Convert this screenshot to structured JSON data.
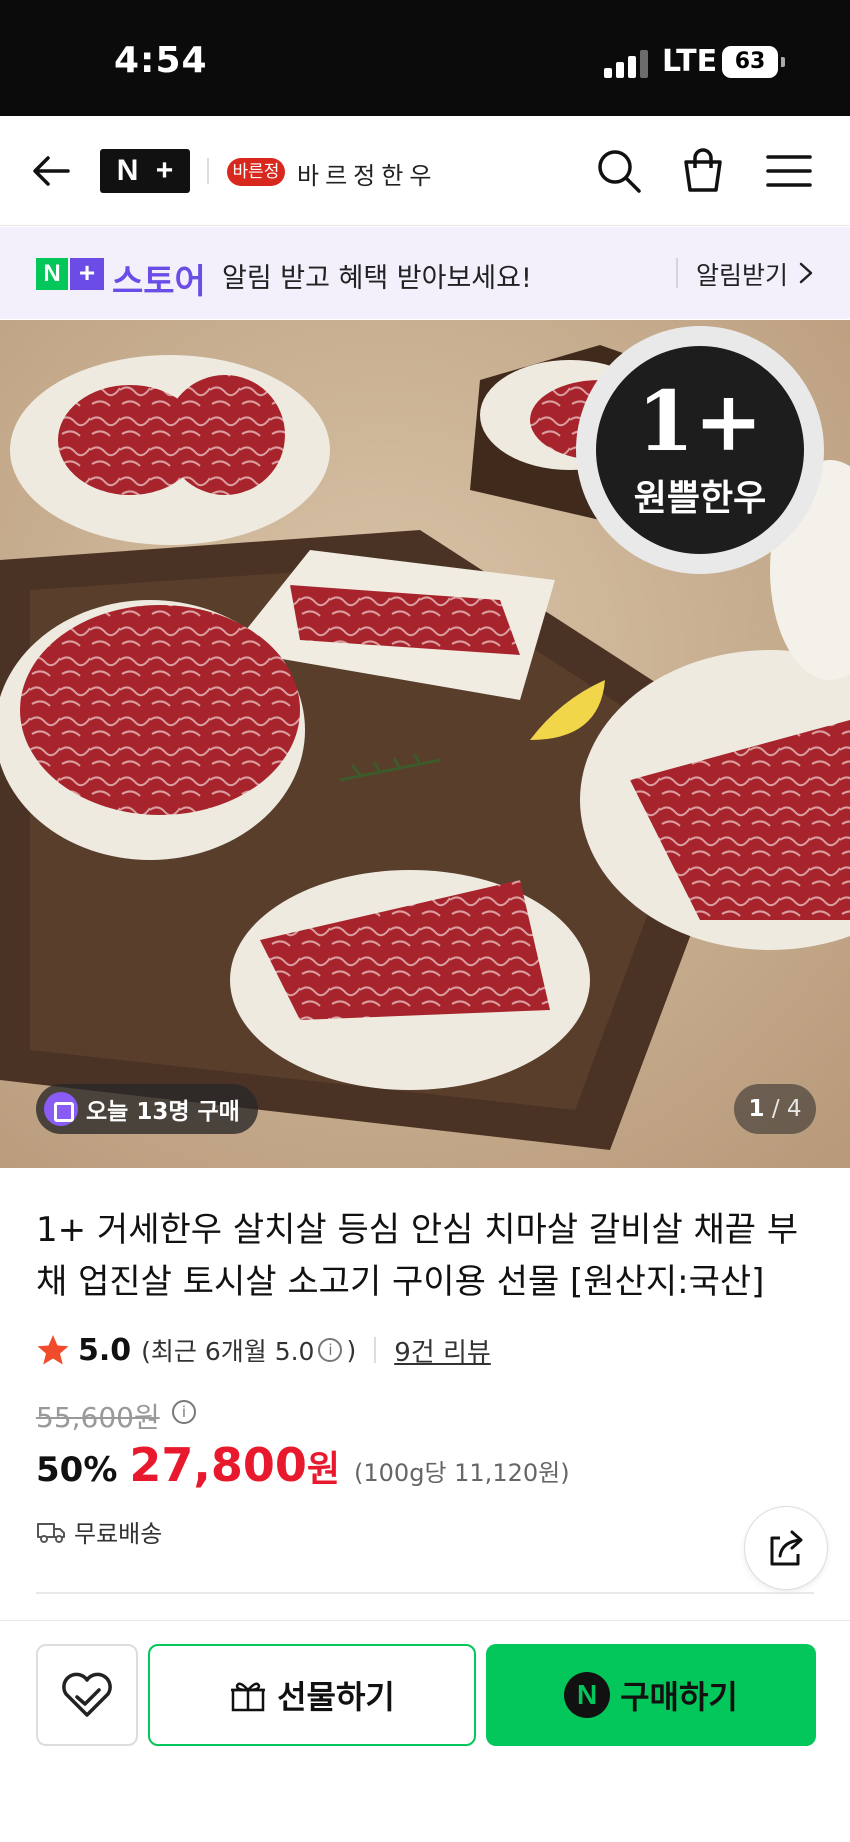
{
  "status_bar": {
    "time": "4:54",
    "network": "LTE",
    "battery": "63"
  },
  "header": {
    "logo_n": "N",
    "logo_plus": "+",
    "brand_badge": "바른정",
    "brand_name": "바르정한우",
    "icons": [
      "back-arrow-icon",
      "search-icon",
      "shopping-bag-icon",
      "hamburger-menu-icon"
    ]
  },
  "store_banner": {
    "logo_n": "N",
    "logo_plus": "+",
    "label": "스토어",
    "message": "알림 받고 혜택 받아보세요!",
    "cta": "알림받기"
  },
  "hero": {
    "badge_top": "1+",
    "badge_bottom": "원쁠한우",
    "today_buyers": "오늘 13명 구매",
    "page_current": "1",
    "page_separator": "/",
    "page_total": "4"
  },
  "product": {
    "title": "1+ 거세한우 살치살 등심 안심 치마살 갈비살 채끝 부채 업진살 토시살 소고기 구이용 선물 [원산지:국산]",
    "rating": "5.0",
    "rating_note_prefix": "(최근 6개월 5.0",
    "rating_note_suffix": ")",
    "review_count": "9건 리뷰",
    "original_price": "55,600원",
    "discount": "50%",
    "price": "27,800",
    "currency": "원",
    "unit_price": "(100g당 11,120원)",
    "shipping": "무료배송"
  },
  "bottom_bar": {
    "gift_label": "선물하기",
    "buy_badge": "N",
    "buy_label": "구매하기"
  },
  "colors": {
    "brand_green": "#03c75a",
    "price_red": "#e8192c",
    "store_purple": "#6b4ce6",
    "banner_bg": "#f3f0fb"
  }
}
